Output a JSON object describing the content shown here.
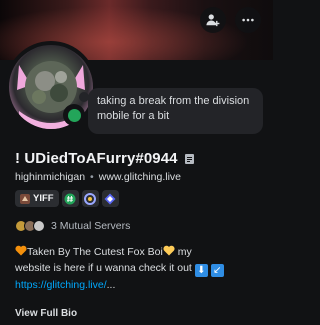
{
  "banner": {
    "colors": [
      "#0b0708",
      "#6b2a2a",
      "#0f0c0d"
    ]
  },
  "header": {
    "add_friend_icon": "person-plus-icon",
    "more_icon": "ellipsis-icon"
  },
  "profile": {
    "status_text": "taking a break from the division mobile for a bit",
    "display_name": "! UDiedToAFurry#0944",
    "username": "highinmichigan",
    "website": "www.glitching.live",
    "separator": "•",
    "status_color": "#23a55a",
    "tag_label": "YIFF",
    "badges": [
      "server-tag-icon",
      "hashtag-badge-icon",
      "circle-badge-icon",
      "hype-squad-icon"
    ],
    "mutual_servers": "3 Mutual Servers",
    "bio": {
      "line1_text": "Taken By The Cutest Fox Boi",
      "line1_after": " my",
      "line2_text": "website is here if u wanna check it out",
      "link": "https://glitching.live/",
      "link_ellipsis": "..."
    },
    "view_full_bio": "View Full Bio"
  }
}
